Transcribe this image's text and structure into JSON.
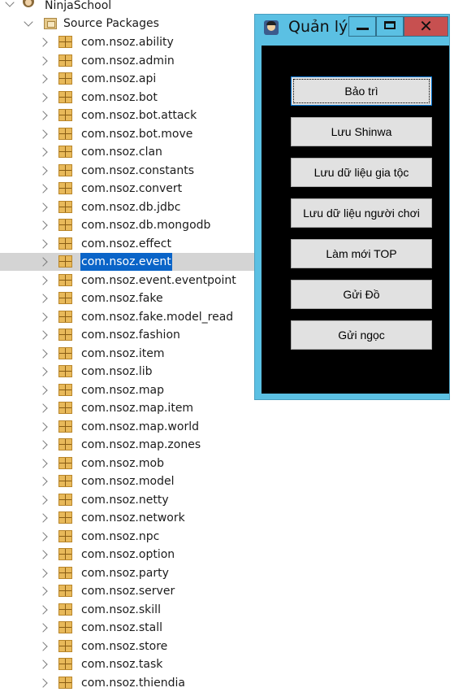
{
  "project": {
    "name": "NinjaSchool",
    "source_packages": "Source Packages"
  },
  "packages": [
    "com.nsoz.ability",
    "com.nsoz.admin",
    "com.nsoz.api",
    "com.nsoz.bot",
    "com.nsoz.bot.attack",
    "com.nsoz.bot.move",
    "com.nsoz.clan",
    "com.nsoz.constants",
    "com.nsoz.convert",
    "com.nsoz.db.jdbc",
    "com.nsoz.db.mongodb",
    "com.nsoz.effect",
    "com.nsoz.event",
    "com.nsoz.event.eventpoint",
    "com.nsoz.fake",
    "com.nsoz.fake.model_read",
    "com.nsoz.fashion",
    "com.nsoz.item",
    "com.nsoz.lib",
    "com.nsoz.map",
    "com.nsoz.map.item",
    "com.nsoz.map.world",
    "com.nsoz.map.zones",
    "com.nsoz.mob",
    "com.nsoz.model",
    "com.nsoz.netty",
    "com.nsoz.network",
    "com.nsoz.npc",
    "com.nsoz.option",
    "com.nsoz.party",
    "com.nsoz.server",
    "com.nsoz.skill",
    "com.nsoz.stall",
    "com.nsoz.store",
    "com.nsoz.task",
    "com.nsoz.thiendia"
  ],
  "selected_package": "com.nsoz.event",
  "window": {
    "title": "Quản lý",
    "close_glyph": "✕",
    "buttons": [
      "Bảo trì",
      "Lưu Shinwa",
      "Lưu dữ liệu gia tộc",
      "Lưu dữ liệu người chơi",
      "Làm mới TOP",
      "Gửi Đồ",
      "Gửi ngọc"
    ]
  },
  "colors": {
    "window_frame": "#5bc0e3",
    "client_bg": "#000000",
    "close_button": "#c75050",
    "selection": "#0a64c8"
  }
}
